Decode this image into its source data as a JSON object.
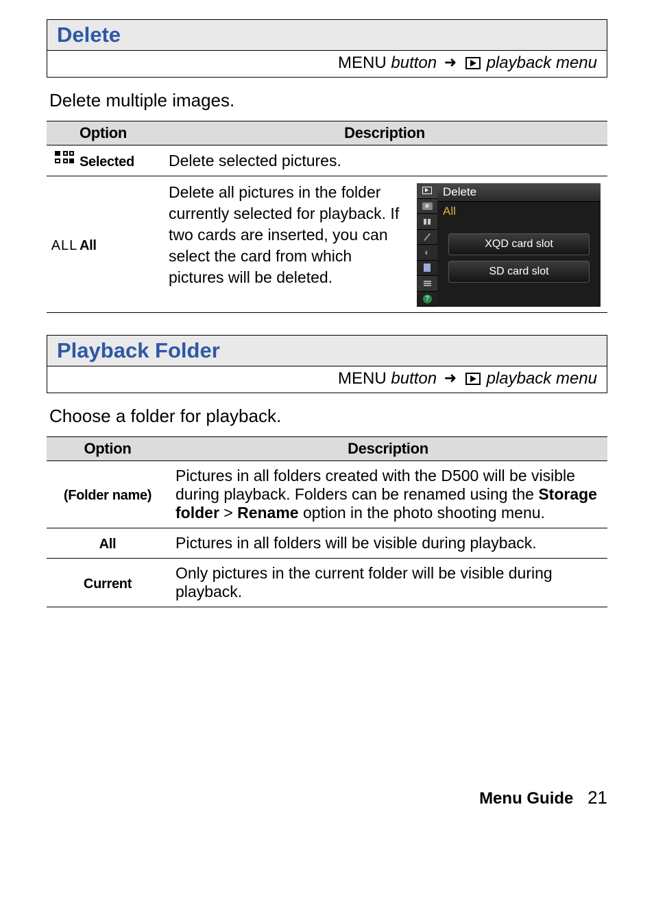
{
  "sections": {
    "delete": {
      "title": "Delete",
      "menu_label": "MENU",
      "menu_suffix_a": "button",
      "menu_suffix_b": "playback menu",
      "intro": "Delete multiple images.",
      "th_option": "Option",
      "th_desc": "Description",
      "row_selected_label": "Selected",
      "row_selected_desc": "Delete selected pictures.",
      "row_all_icon": "ALL",
      "row_all_label": "All",
      "row_all_desc": "Delete all pictures in the folder currently selected for playback. If two cards are inserted, you can select the card from which pictures will be deleted.",
      "ss": {
        "title": "Delete",
        "sub": "All",
        "btn1": "XQD card slot",
        "btn2": "SD card slot"
      }
    },
    "pb": {
      "title": "Playback Folder",
      "menu_label": "MENU",
      "menu_suffix_a": "button",
      "menu_suffix_b": "playback menu",
      "intro": "Choose a folder for playback.",
      "th_option": "Option",
      "th_desc": "Description",
      "row_folder_label": "(Folder name)",
      "row_folder_desc_a": "Pictures in all folders created with the D500 will be visible during playback.  Folders can be renamed using the ",
      "row_folder_bold1": "Storage folder",
      "row_folder_gt": " > ",
      "row_folder_bold2": "Rename",
      "row_folder_desc_b": " option in the photo shooting menu.",
      "row_all_label": "All",
      "row_all_desc": "Pictures in all folders will be visible during playback.",
      "row_cur_label": "Current",
      "row_cur_desc": "Only pictures in the current folder will be visible during playback."
    }
  },
  "footer": {
    "label": "Menu Guide",
    "page": "21"
  }
}
